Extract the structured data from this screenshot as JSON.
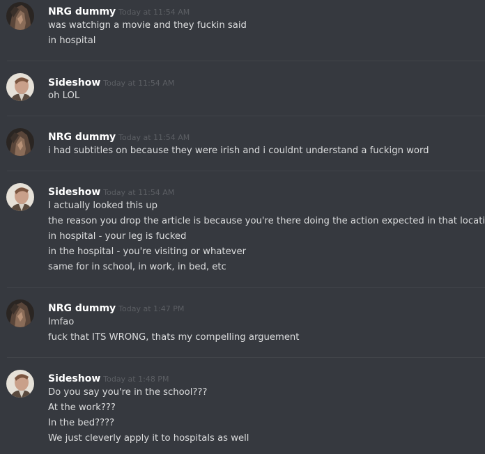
{
  "messages": [
    {
      "username": "NRG dummy",
      "timestamp": "Today at 11:54 AM",
      "avatar": "nrg-avatar",
      "lines": [
        "was watchign a movie and they fuckin said",
        "in hospital"
      ]
    },
    {
      "username": "Sideshow",
      "timestamp": "Today at 11:54 AM",
      "avatar": "sideshow-avatar",
      "lines": [
        "oh LOL"
      ]
    },
    {
      "username": "NRG dummy",
      "timestamp": "Today at 11:54 AM",
      "avatar": "nrg-avatar",
      "lines": [
        "i had subtitles on because they were irish and i couldnt understand a fuckign word"
      ]
    },
    {
      "username": "Sideshow",
      "timestamp": "Today at 11:54 AM",
      "avatar": "sideshow-avatar",
      "lines": [
        "I actually looked this up",
        "the reason you drop the article is because you're there doing the action expected in that location",
        "in hospital - your leg is fucked",
        "in the hospital - you're visiting or whatever",
        "same for in school, in work, in bed, etc"
      ]
    },
    {
      "username": "NRG dummy",
      "timestamp": "Today at 1:47 PM",
      "avatar": "nrg-avatar",
      "lines": [
        "lmfao",
        "fuck that ITS WRONG, thats my compelling arguement"
      ]
    },
    {
      "username": "Sideshow",
      "timestamp": "Today at 1:48 PM",
      "avatar": "sideshow-avatar",
      "lines": [
        "Do you say you're in the school???",
        "At the work???",
        "In the bed????",
        "We just cleverly apply it to hospitals as well"
      ]
    }
  ],
  "colors": {
    "background": "#36393f",
    "username": "#ffffff",
    "timestamp": "#5c5f64",
    "message_text": "#dcddde",
    "divider": "#42454a"
  }
}
